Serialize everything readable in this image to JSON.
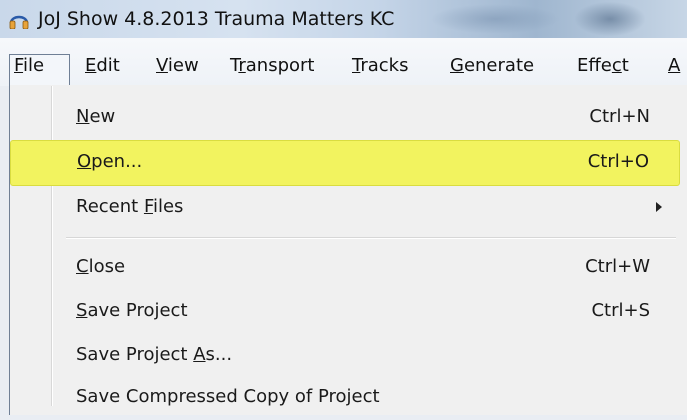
{
  "window": {
    "title": "JoJ Show 4.8.2013 Trauma Matters KC",
    "icon": "headphones-icon"
  },
  "menubar": {
    "items": [
      {
        "label": "File",
        "mnemonic": "F"
      },
      {
        "label": "Edit",
        "mnemonic": "E"
      },
      {
        "label": "View",
        "mnemonic": "V"
      },
      {
        "label": "Transport",
        "mnemonic": "r"
      },
      {
        "label": "Tracks",
        "mnemonic": "T"
      },
      {
        "label": "Generate",
        "mnemonic": "G"
      },
      {
        "label": "Effect",
        "mnemonic": "c"
      },
      {
        "label": "A",
        "mnemonic": "A"
      }
    ]
  },
  "file_menu": {
    "items": [
      {
        "label": "New",
        "shortcut": "Ctrl+N"
      },
      {
        "label": "Open...",
        "shortcut": "Ctrl+O",
        "highlighted": true
      },
      {
        "label": "Recent Files",
        "submenu": true
      },
      {
        "label": "Close",
        "shortcut": "Ctrl+W"
      },
      {
        "label": "Save Project",
        "shortcut": "Ctrl+S"
      },
      {
        "label": "Save Project As...",
        "shortcut": ""
      },
      {
        "label": "Save Compressed Copy of Project",
        "shortcut": ""
      }
    ]
  },
  "colors": {
    "highlight": "#f2f35f",
    "menu_background": "#f0f0f0",
    "icon_accent": "#e8a33a"
  }
}
